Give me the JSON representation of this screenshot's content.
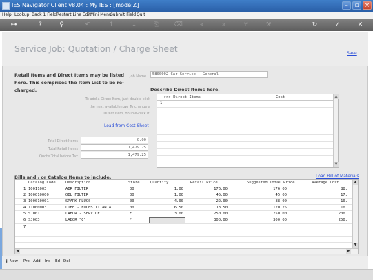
{
  "window": {
    "title": "IES Navigator Client v8.04 : My IES :      [mode:Z]"
  },
  "menu": [
    "Help",
    "Lookup",
    "Back 1 Field",
    "Restart Line Edit",
    "Mini Menu",
    "Submit Field",
    "Quit"
  ],
  "toolbar": {
    "icons": [
      "key-icon",
      "help-icon",
      "search-icon",
      "undo-icon",
      "move-up-icon",
      "move-down-icon",
      "copy-icon",
      "clear-icon",
      "first-page-icon",
      "next-page-icon",
      "branch-icon",
      "tool-icon",
      "refresh-icon",
      "accept-icon",
      "cancel-icon"
    ]
  },
  "page": {
    "title": "Service Job: Quotation / Charge Sheet",
    "save": "Save"
  },
  "retail": {
    "intro": "Retail Items and Direct Items may be listed here. This comprises the Item List to be re-charged.",
    "job_name_label": "Job Name",
    "job_name_value": "5800002 Car Service - General",
    "describe_label": "Describe Direct Items here.",
    "help_text": "To add a Direct Item, just double-click the next available row. To change a Direct Item, double-click it.",
    "load_cost_sheet": "Load from Cost Sheet",
    "totals": [
      {
        "label": "Total Direct Items",
        "value": "0.00"
      },
      {
        "label": "Total Retail Items",
        "value": "1,479.25"
      },
      {
        "label": "Quote Total before Tax",
        "value": "1,479.25"
      }
    ],
    "direct_grid": {
      "col1": ">>> Direct Items",
      "col2": "Cost",
      "first_row": "1"
    }
  },
  "bills": {
    "label": "Bills and / or Catalog Items to include.",
    "load_bom": "Load Bill of Materials",
    "columns": [
      "Catalog Code",
      "Description",
      "Store",
      "Quantity",
      "Retail Price",
      "Suggested Total Price",
      "Average Cost"
    ],
    "rows": [
      {
        "n": "1",
        "code": "10011003",
        "desc": "AIR FILTER",
        "store": "00",
        "qty": "1.00",
        "price": "176.00",
        "total": "176.00",
        "avg": "88."
      },
      {
        "n": "2",
        "code": "100010000",
        "desc": "OIL FILTER",
        "store": "00",
        "qty": "1.00",
        "price": "45.00",
        "total": "45.00",
        "avg": "17."
      },
      {
        "n": "3",
        "code": "100010001",
        "desc": "SPARK PLUGS",
        "store": "00",
        "qty": "4.00",
        "price": "22.00",
        "total": "88.00",
        "avg": "10."
      },
      {
        "n": "4",
        "code": "11000003",
        "desc": "LUBE - FUCHS TITAN A",
        "store": "00",
        "qty": "6.50",
        "price": "18.50",
        "total": "120.25",
        "avg": "10."
      },
      {
        "n": "5",
        "code": "SJ001",
        "desc": "LABOR - SERVICE",
        "store": "*",
        "qty": "3.00",
        "price": "250.00",
        "total": "750.00",
        "avg": "200."
      },
      {
        "n": "6",
        "code": "SJ003",
        "desc": "LABOR \"C\"",
        "store": "*",
        "qty": "",
        "price": "300.00",
        "total": "300.00",
        "avg": "250."
      },
      {
        "n": "7",
        "code": "",
        "desc": "",
        "store": "",
        "qty": "",
        "price": "",
        "total": "",
        "avg": ""
      }
    ]
  },
  "bottombar": [
    "New",
    "Pre",
    "Add",
    "Ins",
    "Ed",
    "Del"
  ]
}
